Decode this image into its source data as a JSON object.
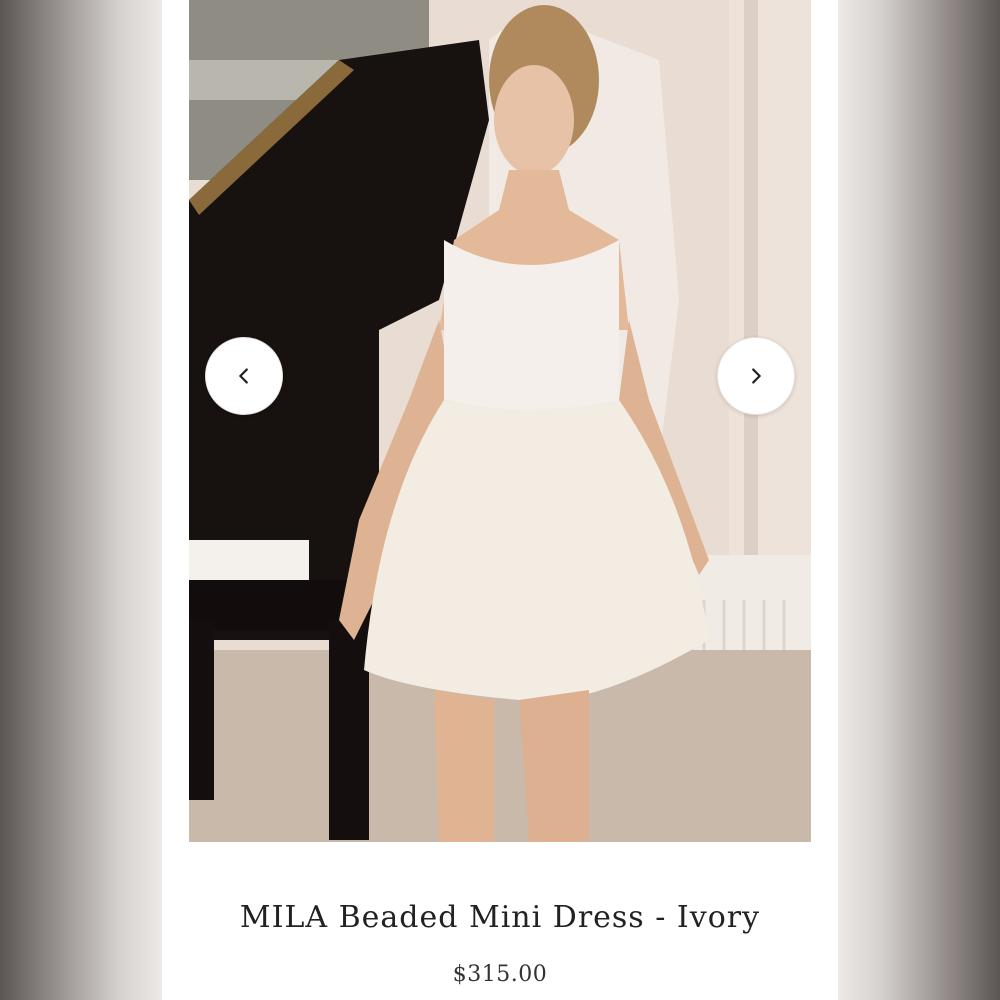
{
  "product": {
    "name": "MILA Beaded Mini Dress - Ivory",
    "price": "$315.00"
  },
  "carousel": {
    "prev_icon": "chevron-left-icon",
    "next_icon": "chevron-right-icon"
  },
  "colors": {
    "page_background": "#ffffff",
    "text": "#222222",
    "button_background": "#ffffff"
  }
}
